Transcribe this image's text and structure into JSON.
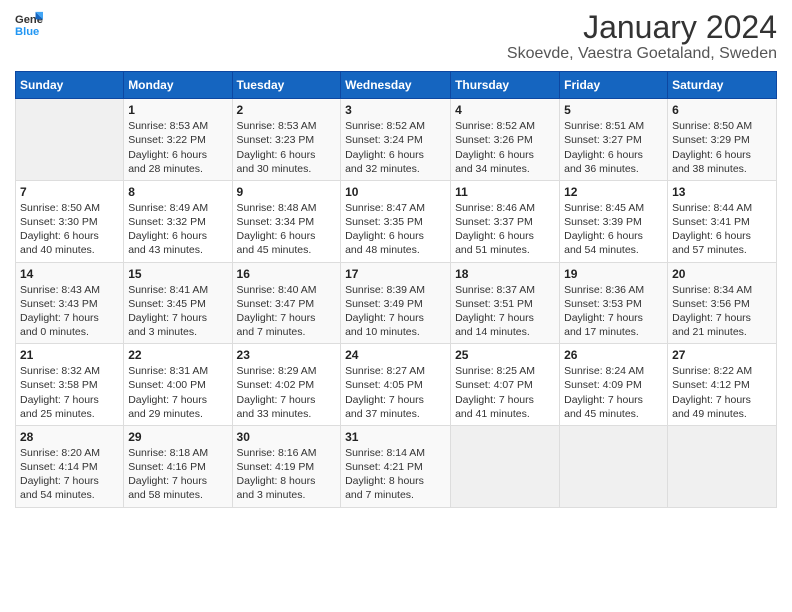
{
  "header": {
    "logo_line1": "General",
    "logo_line2": "Blue",
    "month": "January 2024",
    "location": "Skoevde, Vaestra Goetaland, Sweden"
  },
  "weekdays": [
    "Sunday",
    "Monday",
    "Tuesday",
    "Wednesday",
    "Thursday",
    "Friday",
    "Saturday"
  ],
  "weeks": [
    [
      {
        "num": "",
        "info": ""
      },
      {
        "num": "1",
        "info": "Sunrise: 8:53 AM\nSunset: 3:22 PM\nDaylight: 6 hours\nand 28 minutes."
      },
      {
        "num": "2",
        "info": "Sunrise: 8:53 AM\nSunset: 3:23 PM\nDaylight: 6 hours\nand 30 minutes."
      },
      {
        "num": "3",
        "info": "Sunrise: 8:52 AM\nSunset: 3:24 PM\nDaylight: 6 hours\nand 32 minutes."
      },
      {
        "num": "4",
        "info": "Sunrise: 8:52 AM\nSunset: 3:26 PM\nDaylight: 6 hours\nand 34 minutes."
      },
      {
        "num": "5",
        "info": "Sunrise: 8:51 AM\nSunset: 3:27 PM\nDaylight: 6 hours\nand 36 minutes."
      },
      {
        "num": "6",
        "info": "Sunrise: 8:50 AM\nSunset: 3:29 PM\nDaylight: 6 hours\nand 38 minutes."
      }
    ],
    [
      {
        "num": "7",
        "info": "Sunrise: 8:50 AM\nSunset: 3:30 PM\nDaylight: 6 hours\nand 40 minutes."
      },
      {
        "num": "8",
        "info": "Sunrise: 8:49 AM\nSunset: 3:32 PM\nDaylight: 6 hours\nand 43 minutes."
      },
      {
        "num": "9",
        "info": "Sunrise: 8:48 AM\nSunset: 3:34 PM\nDaylight: 6 hours\nand 45 minutes."
      },
      {
        "num": "10",
        "info": "Sunrise: 8:47 AM\nSunset: 3:35 PM\nDaylight: 6 hours\nand 48 minutes."
      },
      {
        "num": "11",
        "info": "Sunrise: 8:46 AM\nSunset: 3:37 PM\nDaylight: 6 hours\nand 51 minutes."
      },
      {
        "num": "12",
        "info": "Sunrise: 8:45 AM\nSunset: 3:39 PM\nDaylight: 6 hours\nand 54 minutes."
      },
      {
        "num": "13",
        "info": "Sunrise: 8:44 AM\nSunset: 3:41 PM\nDaylight: 6 hours\nand 57 minutes."
      }
    ],
    [
      {
        "num": "14",
        "info": "Sunrise: 8:43 AM\nSunset: 3:43 PM\nDaylight: 7 hours\nand 0 minutes."
      },
      {
        "num": "15",
        "info": "Sunrise: 8:41 AM\nSunset: 3:45 PM\nDaylight: 7 hours\nand 3 minutes."
      },
      {
        "num": "16",
        "info": "Sunrise: 8:40 AM\nSunset: 3:47 PM\nDaylight: 7 hours\nand 7 minutes."
      },
      {
        "num": "17",
        "info": "Sunrise: 8:39 AM\nSunset: 3:49 PM\nDaylight: 7 hours\nand 10 minutes."
      },
      {
        "num": "18",
        "info": "Sunrise: 8:37 AM\nSunset: 3:51 PM\nDaylight: 7 hours\nand 14 minutes."
      },
      {
        "num": "19",
        "info": "Sunrise: 8:36 AM\nSunset: 3:53 PM\nDaylight: 7 hours\nand 17 minutes."
      },
      {
        "num": "20",
        "info": "Sunrise: 8:34 AM\nSunset: 3:56 PM\nDaylight: 7 hours\nand 21 minutes."
      }
    ],
    [
      {
        "num": "21",
        "info": "Sunrise: 8:32 AM\nSunset: 3:58 PM\nDaylight: 7 hours\nand 25 minutes."
      },
      {
        "num": "22",
        "info": "Sunrise: 8:31 AM\nSunset: 4:00 PM\nDaylight: 7 hours\nand 29 minutes."
      },
      {
        "num": "23",
        "info": "Sunrise: 8:29 AM\nSunset: 4:02 PM\nDaylight: 7 hours\nand 33 minutes."
      },
      {
        "num": "24",
        "info": "Sunrise: 8:27 AM\nSunset: 4:05 PM\nDaylight: 7 hours\nand 37 minutes."
      },
      {
        "num": "25",
        "info": "Sunrise: 8:25 AM\nSunset: 4:07 PM\nDaylight: 7 hours\nand 41 minutes."
      },
      {
        "num": "26",
        "info": "Sunrise: 8:24 AM\nSunset: 4:09 PM\nDaylight: 7 hours\nand 45 minutes."
      },
      {
        "num": "27",
        "info": "Sunrise: 8:22 AM\nSunset: 4:12 PM\nDaylight: 7 hours\nand 49 minutes."
      }
    ],
    [
      {
        "num": "28",
        "info": "Sunrise: 8:20 AM\nSunset: 4:14 PM\nDaylight: 7 hours\nand 54 minutes."
      },
      {
        "num": "29",
        "info": "Sunrise: 8:18 AM\nSunset: 4:16 PM\nDaylight: 7 hours\nand 58 minutes."
      },
      {
        "num": "30",
        "info": "Sunrise: 8:16 AM\nSunset: 4:19 PM\nDaylight: 8 hours\nand 3 minutes."
      },
      {
        "num": "31",
        "info": "Sunrise: 8:14 AM\nSunset: 4:21 PM\nDaylight: 8 hours\nand 7 minutes."
      },
      {
        "num": "",
        "info": ""
      },
      {
        "num": "",
        "info": ""
      },
      {
        "num": "",
        "info": ""
      }
    ]
  ]
}
